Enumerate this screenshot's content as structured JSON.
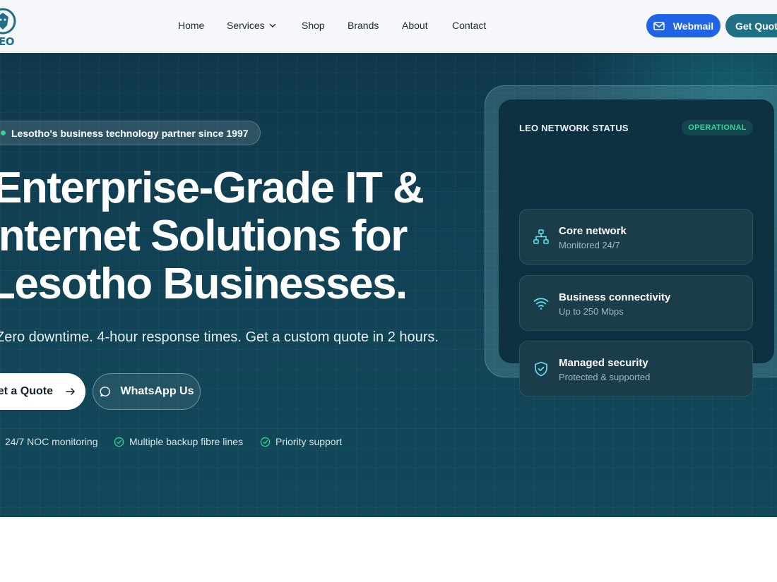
{
  "header": {
    "logo_text": "EO",
    "nav": [
      {
        "label": "Home"
      },
      {
        "label": "Services"
      },
      {
        "label": "Shop"
      },
      {
        "label": "Brands"
      },
      {
        "label": "About"
      },
      {
        "label": "Contact"
      }
    ],
    "webmail_label": "Webmail",
    "get_quote_label": "Get Quote"
  },
  "hero": {
    "pill_text": "Lesotho's business technology partner since 1997",
    "headline": [
      "Enterprise-Grade IT &",
      "Internet Solutions for",
      "Lesotho Businesses."
    ],
    "subline": "Zero downtime. 4-hour response times. Get a custom quote in 2 hours.",
    "cta_primary": "Get a Quote",
    "cta_secondary": "WhatsApp Us",
    "features": [
      "24/7 NOC monitoring",
      "Multiple backup fibre lines",
      "Priority support"
    ]
  },
  "status_card": {
    "title": "LEO NETWORK STATUS",
    "badge": "OPERATIONAL",
    "rows": [
      {
        "title": "Core network",
        "subtitle": "Monitored 24/7",
        "icon": "network-icon"
      },
      {
        "title": "Business connectivity",
        "subtitle": "Up to 250 Mbps",
        "icon": "wifi-icon"
      },
      {
        "title": "Managed security",
        "subtitle": "Protected & supported",
        "icon": "shield-check-icon"
      }
    ]
  },
  "colors": {
    "brand_teal": "#1f6f86",
    "webmail_blue": "#1f63e6",
    "hero_bg": "#114456",
    "status_green": "#34d399",
    "icon_cyan": "#5ee0f0"
  }
}
